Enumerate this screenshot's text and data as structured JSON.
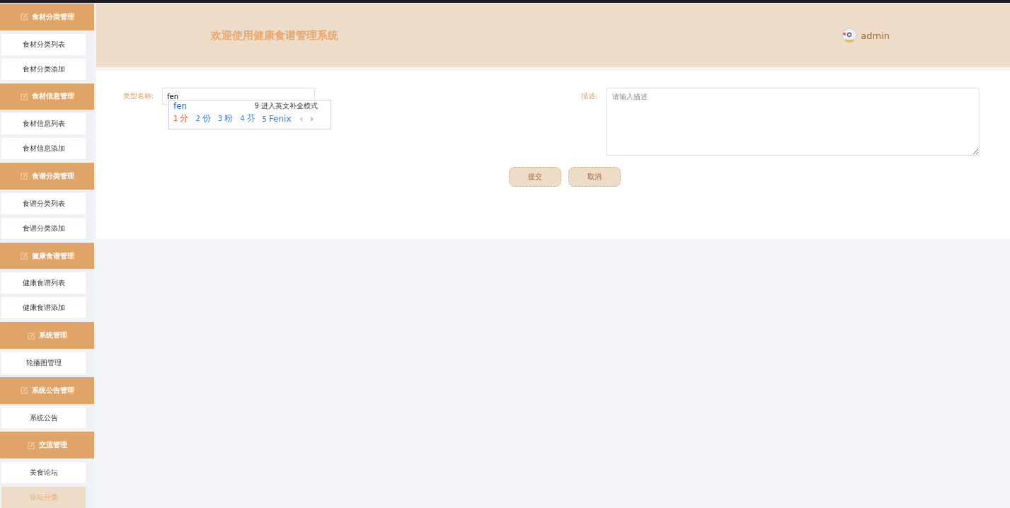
{
  "sidebar": {
    "groups": [
      {
        "title": "食材分类管理",
        "items": [
          {
            "label": "食材分类列表",
            "selected": false
          },
          {
            "label": "食材分类添加",
            "selected": false
          }
        ]
      },
      {
        "title": "食材信息管理",
        "items": [
          {
            "label": "食材信息列表",
            "selected": false
          },
          {
            "label": "食材信息添加",
            "selected": false
          }
        ]
      },
      {
        "title": "食谱分类管理",
        "items": [
          {
            "label": "食谱分类列表",
            "selected": false
          },
          {
            "label": "食谱分类添加",
            "selected": false
          }
        ]
      },
      {
        "title": "健康食谱管理",
        "items": [
          {
            "label": "健康食谱列表",
            "selected": false
          },
          {
            "label": "健康食谱添加",
            "selected": false
          }
        ]
      },
      {
        "title": "系统管理",
        "items": [
          {
            "label": "轮播图管理",
            "selected": false
          }
        ]
      },
      {
        "title": "系统公告管理",
        "items": [
          {
            "label": "系统公告",
            "selected": false
          }
        ]
      },
      {
        "title": "交流管理",
        "items": [
          {
            "label": "美食论坛",
            "selected": false
          },
          {
            "label": "论坛分类",
            "selected": true
          }
        ]
      }
    ]
  },
  "header": {
    "title": "欢迎使用健康食谱管理系统",
    "user": "admin"
  },
  "form": {
    "name_label": "类型名称:",
    "name_value": "fen",
    "desc_label": "描述:",
    "desc_placeholder": "请输入描述",
    "buttons": [
      "提交",
      "取消"
    ]
  },
  "ime_popup": {
    "composition": "fen",
    "hint": "9 进入英文补全模式",
    "candidates": [
      {
        "index": "1",
        "text": "分",
        "selected": true
      },
      {
        "index": "2",
        "text": "份",
        "selected": false
      },
      {
        "index": "3",
        "text": "粉",
        "selected": false
      },
      {
        "index": "4",
        "text": "芬",
        "selected": false
      },
      {
        "index": "5",
        "text": "Fenix",
        "selected": false
      }
    ],
    "prev": "‹",
    "next": "›"
  }
}
